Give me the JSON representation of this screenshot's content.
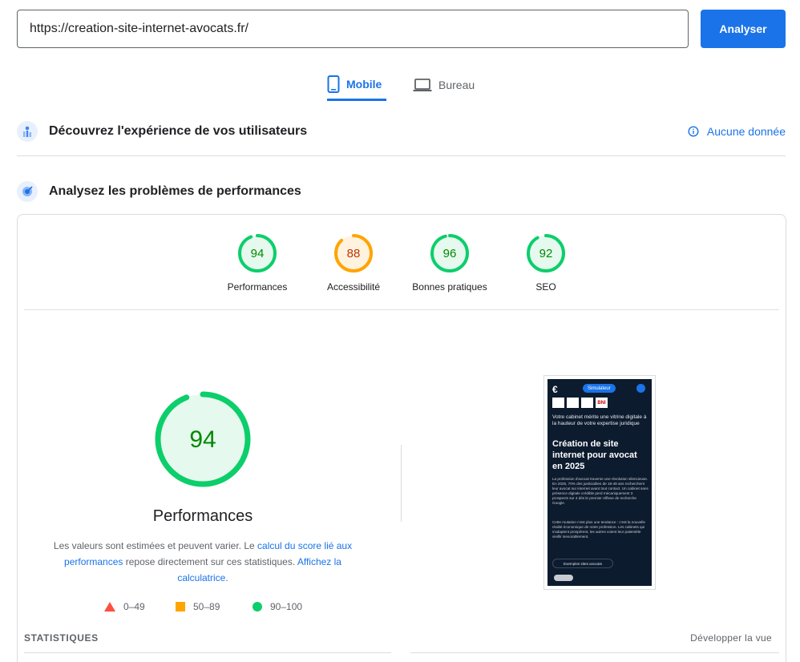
{
  "search": {
    "url": "https://creation-site-internet-avocats.fr/",
    "analyze_label": "Analyser"
  },
  "tabs": [
    {
      "label": "Mobile",
      "icon": "smartphone-icon",
      "active": true
    },
    {
      "label": "Bureau",
      "icon": "laptop-icon",
      "active": false
    }
  ],
  "field_data": {
    "title": "Découvrez l'expérience de vos utilisateurs",
    "no_data_label": "Aucune donnée"
  },
  "lab_data": {
    "title": "Analysez les problèmes de performances"
  },
  "scores": [
    {
      "label": "Performances",
      "value": 94,
      "color": "#0cce6b",
      "text_color": "#008800",
      "bg": "#e6f9ee"
    },
    {
      "label": "Accessibilité",
      "value": 88,
      "color": "#ffa400",
      "text_color": "#c33300",
      "bg": "#fff3e0"
    },
    {
      "label": "Bonnes pratiques",
      "value": 96,
      "color": "#0cce6b",
      "text_color": "#008800",
      "bg": "#e6f9ee"
    },
    {
      "label": "SEO",
      "value": 92,
      "color": "#0cce6b",
      "text_color": "#008800",
      "bg": "#e6f9ee"
    }
  ],
  "main_score": {
    "label": "Performances",
    "value": 94
  },
  "description": {
    "before": "Les valeurs sont estimées et peuvent varier. Le ",
    "link1": "calcul du score lié aux performances",
    "middle": " repose directement sur ces statistiques. ",
    "link2": "Affichez la calculatrice",
    "after": "."
  },
  "legend": [
    {
      "range": "0–49",
      "shape": "triangle",
      "color": "#ff4e42"
    },
    {
      "range": "50–89",
      "shape": "square",
      "color": "#ffa400"
    },
    {
      "range": "90–100",
      "shape": "circle",
      "color": "#0cce6b"
    }
  ],
  "statistics_label": "STATISTIQUES",
  "expand_label": "Développer la vue",
  "screenshot": {
    "simulator_label": "Simulateur",
    "badge_label": "BNI",
    "intro": "Votre cabinet mérite une vitrine digitale à la hauteur de votre expertise juridique",
    "heading": "Création de site internet pour avocat en 2025",
    "para1": "La profession d'avocat traverse une révolution silencieuse. En 2025, 70% des justiciables de 18-49 ans recherchent leur avocat sur internet avant tout contact. Un cabinet sans présence digitale crédible perd mécaniquement 3 prospects sur 4 dès le premier réflexe de recherche Google.",
    "para2": "Cette mutation n'est plus une tendance : c'est la nouvelle réalité économique de notre profession. Les cabinets qui s'adaptent prospèrent, les autres voient leur patientèle vieillir inexorablement.",
    "button": "Exemples sites avocats"
  }
}
